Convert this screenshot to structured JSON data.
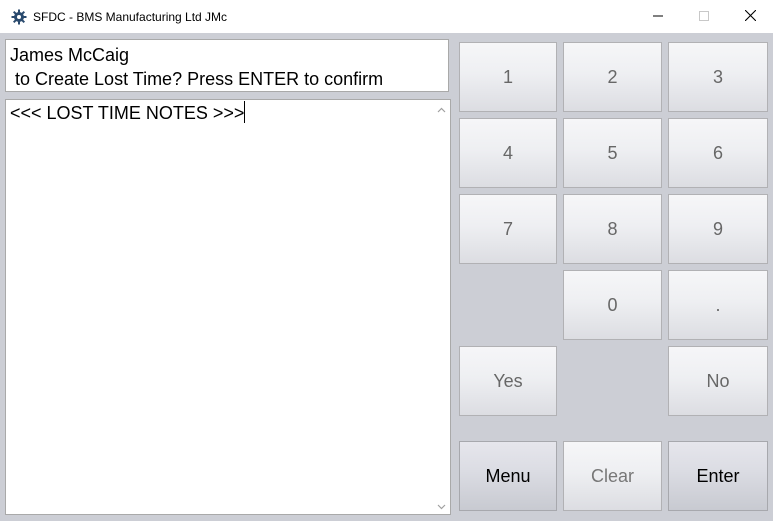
{
  "window": {
    "title": "SFDC - BMS Manufacturing Ltd JMc",
    "icons": {
      "app": "gear-icon",
      "minimize": "minimize-icon",
      "maximize": "maximize-icon",
      "close": "close-icon"
    }
  },
  "message": {
    "line1": "James McCaig",
    "line2": " to Create Lost Time? Press ENTER to confirm"
  },
  "notes": {
    "text": "<<< LOST TIME NOTES >>>"
  },
  "keypad": {
    "k1": "1",
    "k2": "2",
    "k3": "3",
    "k4": "4",
    "k5": "5",
    "k6": "6",
    "k7": "7",
    "k8": "8",
    "k9": "9",
    "k0": "0",
    "dot": ".",
    "yes": "Yes",
    "no": "No",
    "menu": "Menu",
    "clear": "Clear",
    "enter": "Enter"
  },
  "colors": {
    "client_bg": "#ccced5",
    "key_text": "#676767",
    "active_key_text": "#000000"
  }
}
